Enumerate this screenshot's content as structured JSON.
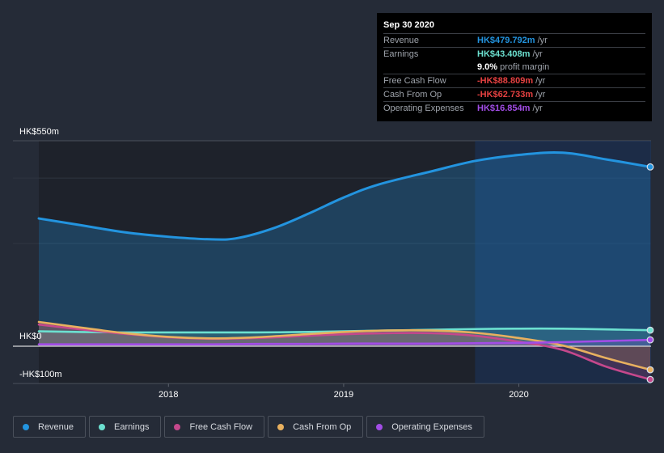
{
  "tooltip": {
    "date": "Sep 30 2020",
    "rows": [
      {
        "label": "Revenue",
        "value": "HK$479.792m",
        "unit": "/yr",
        "color": "#2394df"
      },
      {
        "label": "Earnings",
        "value": "HK$43.408m",
        "unit": "/yr",
        "color": "#6ce0d0"
      },
      {
        "label": "",
        "value": "9.0%",
        "unit": "profit margin",
        "color": "#ffffff"
      },
      {
        "label": "Free Cash Flow",
        "value": "-HK$88.809m",
        "unit": "/yr",
        "color": "#e64141"
      },
      {
        "label": "Cash From Op",
        "value": "-HK$62.733m",
        "unit": "/yr",
        "color": "#e64141"
      },
      {
        "label": "Operating Expenses",
        "value": "HK$16.854m",
        "unit": "/yr",
        "color": "#a24de6"
      }
    ]
  },
  "legend": [
    {
      "label": "Revenue",
      "color": "#2394df"
    },
    {
      "label": "Earnings",
      "color": "#6ce0d0"
    },
    {
      "label": "Free Cash Flow",
      "color": "#c5488c"
    },
    {
      "label": "Cash From Op",
      "color": "#e8b05f"
    },
    {
      "label": "Operating Expenses",
      "color": "#a24de6"
    }
  ],
  "chart_data": {
    "type": "area",
    "title": "",
    "xlabel": "",
    "ylabel": "",
    "currency": "HK$",
    "y_tick_labels": [
      "HK$550m",
      "HK$0",
      "-HK$100m"
    ],
    "y_ticks": [
      550,
      0,
      -100
    ],
    "ylim": [
      -100,
      550
    ],
    "xlim": [
      2017.26,
      2020.75
    ],
    "x_tick_labels": [
      "2018",
      "2019",
      "2020"
    ],
    "x_ticks": [
      2018,
      2019,
      2020
    ],
    "grid": true,
    "legend_position": "bottom-left",
    "highlight_range": [
      2019.75,
      2020.75
    ],
    "series": [
      {
        "name": "Revenue",
        "color": "#2394df",
        "x": [
          2017.26,
          2017.5,
          2017.75,
          2018.0,
          2018.25,
          2018.4,
          2018.6,
          2018.8,
          2019.0,
          2019.2,
          2019.5,
          2019.75,
          2020.0,
          2020.25,
          2020.5,
          2020.75
        ],
        "values": [
          342,
          324,
          305,
          293,
          286,
          290,
          316,
          355,
          398,
          433,
          468,
          496,
          512,
          518,
          500,
          480
        ]
      },
      {
        "name": "Earnings",
        "color": "#6ce0d0",
        "x": [
          2017.26,
          2017.5,
          2017.75,
          2018.0,
          2018.25,
          2018.5,
          2018.75,
          2019.0,
          2019.25,
          2019.5,
          2019.75,
          2020.0,
          2020.25,
          2020.5,
          2020.75
        ],
        "values": [
          40,
          38,
          37,
          37,
          37,
          37,
          38,
          40,
          42,
          44,
          46,
          47,
          47,
          45,
          43
        ]
      },
      {
        "name": "Free Cash Flow",
        "color": "#c5488c",
        "x": [
          2017.26,
          2017.5,
          2017.75,
          2018.0,
          2018.25,
          2018.5,
          2018.75,
          2019.0,
          2019.25,
          2019.5,
          2019.75,
          2020.0,
          2020.25,
          2020.5,
          2020.75
        ],
        "values": [
          58,
          45,
          33,
          24,
          20,
          22,
          27,
          32,
          35,
          35,
          28,
          12,
          -10,
          -55,
          -89
        ]
      },
      {
        "name": "Cash From Op",
        "color": "#e8b05f",
        "x": [
          2017.26,
          2017.5,
          2017.75,
          2018.0,
          2018.25,
          2018.5,
          2018.75,
          2019.0,
          2019.25,
          2019.5,
          2019.75,
          2020.0,
          2020.25,
          2020.5,
          2020.75
        ],
        "values": [
          65,
          50,
          35,
          25,
          21,
          24,
          31,
          38,
          42,
          42,
          36,
          22,
          2,
          -32,
          -63
        ]
      },
      {
        "name": "Operating Expenses",
        "color": "#a24de6",
        "x": [
          2017.26,
          2017.5,
          2017.75,
          2018.0,
          2018.25,
          2018.5,
          2018.75,
          2019.0,
          2019.25,
          2019.5,
          2019.75,
          2020.0,
          2020.25,
          2020.5,
          2020.75
        ],
        "values": [
          5,
          5,
          5,
          5,
          5,
          6,
          6,
          7,
          7,
          7,
          8,
          9,
          11,
          14,
          17
        ]
      }
    ]
  }
}
